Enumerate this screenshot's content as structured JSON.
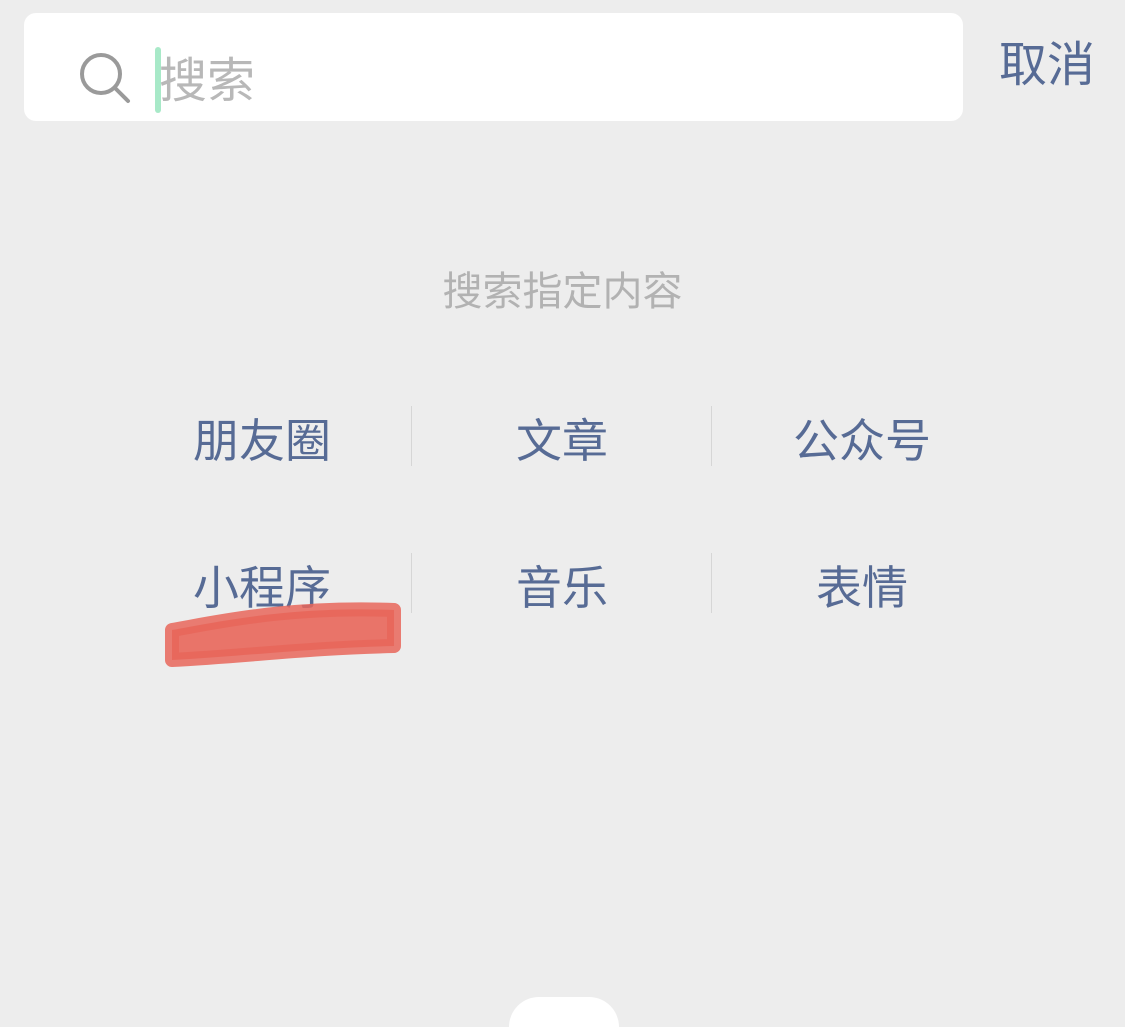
{
  "search": {
    "placeholder": "搜索",
    "value": "",
    "cancel_label": "取消"
  },
  "section": {
    "title": "搜索指定内容"
  },
  "categories": [
    [
      "朋友圈",
      "文章",
      "公众号"
    ],
    [
      "小程序",
      "音乐",
      "表情"
    ]
  ],
  "colors": {
    "background": "#ededed",
    "link": "#576b95",
    "muted_text": "#b2b2b2",
    "caret": "#07c160",
    "highlight_mark": "#e8665a"
  },
  "icons": {
    "search": "search-icon",
    "annotation": "red-highlight-scribble"
  }
}
